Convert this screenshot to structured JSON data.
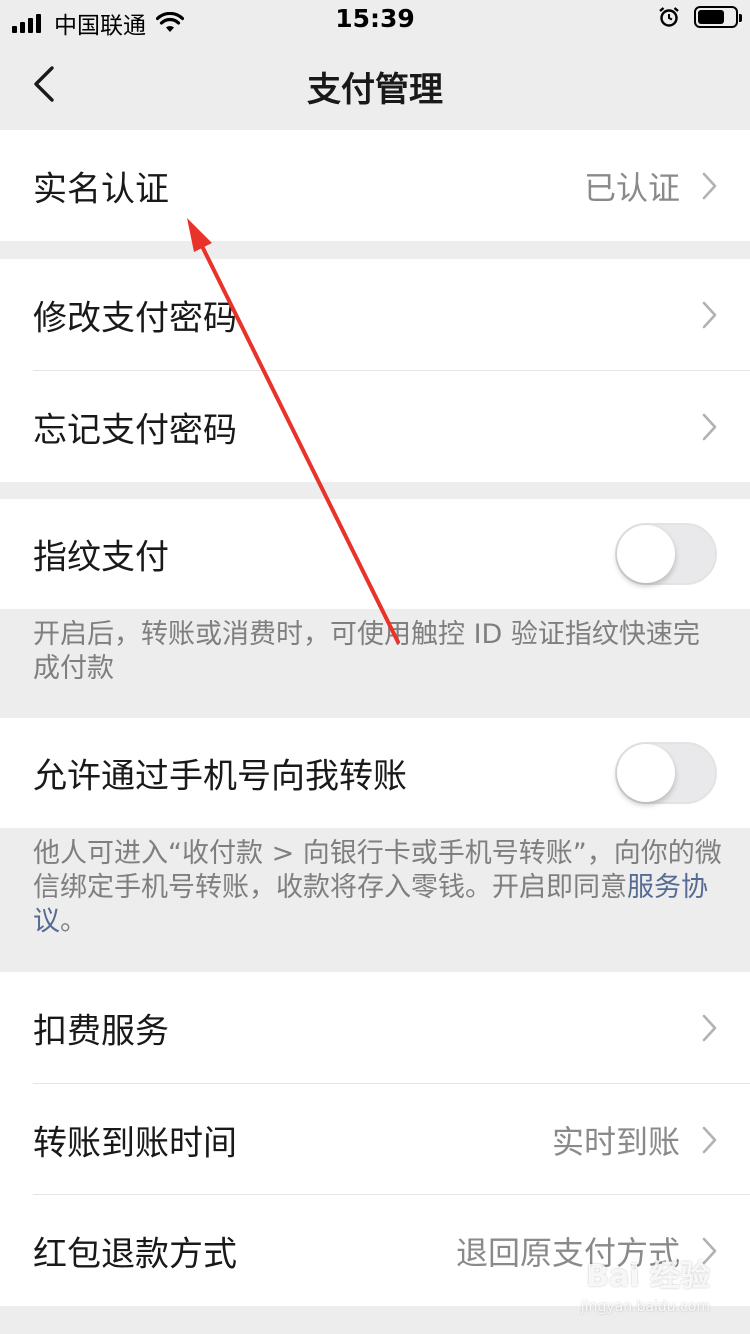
{
  "status_bar": {
    "carrier": "中国联通",
    "time": "15:39"
  },
  "nav": {
    "title": "支付管理"
  },
  "rows": {
    "real_name": {
      "label": "实名认证",
      "value": "已认证"
    },
    "modify_password": {
      "label": "修改支付密码"
    },
    "forgot_password": {
      "label": "忘记支付密码"
    },
    "fingerprint": {
      "label": "指纹支付",
      "enabled": false
    },
    "phone_transfer": {
      "label": "允许通过手机号向我转账",
      "enabled": false
    },
    "deduction": {
      "label": "扣费服务"
    },
    "transfer_time": {
      "label": "转账到账时间",
      "value": "实时到账"
    },
    "red_packet_refund": {
      "label": "红包退款方式",
      "value": "退回原支付方式"
    }
  },
  "notes": {
    "fingerprint": "开启后，转账或消费时，可使用触控 ID 验证指纹快速完成付款",
    "phone_transfer_prefix": "他人可进入“收付款 > 向银行卡或手机号转账”，向你的微信绑定手机号转账，收款将存入零钱。开启即同意",
    "phone_transfer_link": "服务协议",
    "phone_transfer_suffix": "。"
  },
  "watermark": {
    "brand": "Bai 经验",
    "url": "jingyan.baidu.com"
  },
  "colors": {
    "background": "#ededed",
    "link": "#576b95",
    "annotation": "#e8322a"
  }
}
